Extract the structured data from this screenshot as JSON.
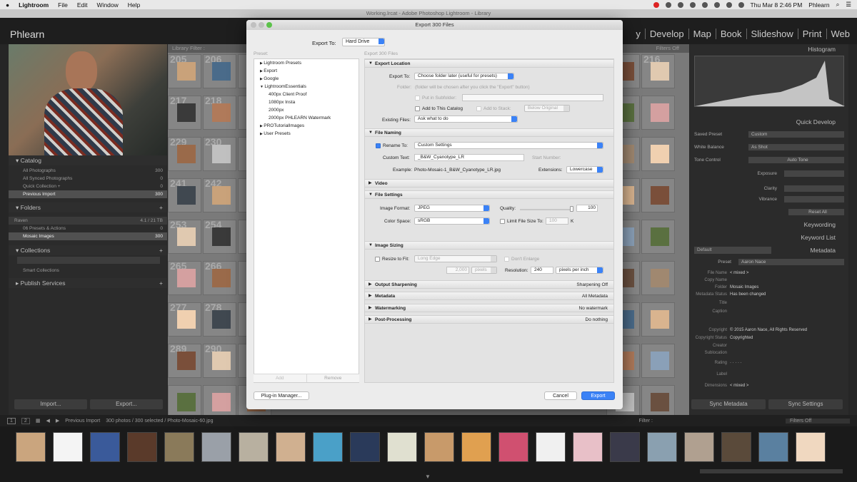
{
  "menubar": {
    "app": "Lightroom",
    "items": [
      "File",
      "Edit",
      "Window",
      "Help"
    ],
    "clock": "Thu Mar 8  2:46 PM",
    "user": "Phlearn"
  },
  "lr": {
    "window_title": "Working.lrcat - Adobe Photoshop Lightroom - Library",
    "brand": "Phlearn",
    "modules": [
      "y",
      "Develop",
      "Map",
      "Book",
      "Slideshow",
      "Print",
      "Web"
    ],
    "library_filter": "Library Filter :",
    "filters_off": "Filters Off"
  },
  "left": {
    "catalog": {
      "title": "Catalog",
      "items": [
        {
          "label": "All Photographs",
          "count": "300",
          "selected": false
        },
        {
          "label": "All Synced Photographs",
          "count": "0",
          "selected": false
        },
        {
          "label": "Quick Collection +",
          "count": "0",
          "selected": false
        },
        {
          "label": "Previous Import",
          "count": "300",
          "selected": true
        }
      ]
    },
    "folders": {
      "title": "Folders",
      "volume": "Raven",
      "volume_info": "4.1 / 21 TB",
      "items": [
        {
          "label": "06 Presets & Actions",
          "count": "0"
        },
        {
          "label": "Mosaic Images",
          "count": "300"
        }
      ]
    },
    "collections": {
      "title": "Collections",
      "items": [
        "Smart Collections"
      ]
    },
    "publish": "Publish Services",
    "import_btn": "Import...",
    "export_btn": "Export..."
  },
  "grid": {
    "row_numbers": [
      "205",
      "206",
      "217",
      "218",
      "229",
      "230",
      "241",
      "242",
      "253",
      "254",
      "265",
      "266",
      "277",
      "278",
      "289",
      "290"
    ],
    "right_numbers": [
      "216"
    ]
  },
  "right": {
    "histogram": "Histogram",
    "quick_develop": "Quick Develop",
    "saved_preset": {
      "label": "Saved Preset",
      "value": "Custom"
    },
    "white_balance": {
      "label": "White Balance",
      "value": "As Shot"
    },
    "tone_control": {
      "label": "Tone Control",
      "value": "Auto Tone"
    },
    "sliders": [
      "Exposure",
      "Clarity",
      "Vibrance"
    ],
    "reset": "Reset All",
    "keywording": "Keywording",
    "keyword_list": "Keyword List",
    "metadata": "Metadata",
    "meta_default": "Default",
    "meta_preset": {
      "label": "Preset",
      "value": "Aaron Nace"
    },
    "meta_rows": [
      {
        "k": "File Name",
        "v": "< mixed >"
      },
      {
        "k": "Copy Name",
        "v": ""
      },
      {
        "k": "Folder",
        "v": "Mosaic Images"
      },
      {
        "k": "Metadata Status",
        "v": "Has been changed"
      },
      {
        "k": "Title",
        "v": ""
      },
      {
        "k": "Caption",
        "v": ""
      },
      {
        "k": "Copyright",
        "v": "© 2015 Aaron Nace, All Rights Reserved"
      },
      {
        "k": "Copyright Status",
        "v": "Copyrighted"
      },
      {
        "k": "Creator",
        "v": ""
      },
      {
        "k": "Sublocation",
        "v": ""
      },
      {
        "k": "Rating",
        "v": "· · · · ·"
      },
      {
        "k": "Label",
        "v": ""
      },
      {
        "k": "Dimensions",
        "v": "< mixed >"
      }
    ],
    "sync_metadata": "Sync Metadata",
    "sync_settings": "Sync Settings"
  },
  "bottom": {
    "source": "Previous Import",
    "count": "300 photos / 300 selected / Photo-Mosaic-60.jpg",
    "filter": "Filter :",
    "filters_off": "Filters Off"
  },
  "dialog": {
    "title": "Export 300 Files",
    "export_to_label": "Export To:",
    "export_to_value": "Hard Drive",
    "preset_label": "Preset:",
    "files_label": "Export 300 Files",
    "presets": [
      {
        "label": "Lightroom Presets",
        "indent": 0,
        "arrow": "▶"
      },
      {
        "label": "Export",
        "indent": 0,
        "arrow": "▶"
      },
      {
        "label": "Google",
        "indent": 0,
        "arrow": "▶"
      },
      {
        "label": "LightroomEssentials",
        "indent": 0,
        "arrow": "▼"
      },
      {
        "label": "400px Client Proof",
        "indent": 1,
        "arrow": ""
      },
      {
        "label": "1080px Insta",
        "indent": 1,
        "arrow": ""
      },
      {
        "label": "2000px",
        "indent": 1,
        "arrow": ""
      },
      {
        "label": "2000px PHLEARN Watermark",
        "indent": 1,
        "arrow": ""
      },
      {
        "label": "PROTutorialImages",
        "indent": 0,
        "arrow": "▶"
      },
      {
        "label": "User Presets",
        "indent": 0,
        "arrow": "▶"
      }
    ],
    "add": "Add",
    "remove": "Remove",
    "location": {
      "title": "Export Location",
      "export_to_label": "Export To:",
      "export_to_value": "Choose folder later (useful for presets)",
      "folder_label": "Folder:",
      "folder_note": "(folder will be chosen after you click the \"Export\" button)",
      "subfolder_label": "Put in Subfolder:",
      "add_catalog_label": "Add to This Catalog",
      "add_stack_label": "Add to Stack:",
      "stack_value": "Below Original",
      "existing_label": "Existing Files:",
      "existing_value": "Ask what to do"
    },
    "naming": {
      "title": "File Naming",
      "rename_label": "Rename To:",
      "rename_value": "Custom Settings",
      "custom_text_label": "Custom Text:",
      "custom_text_value": "_B&W_Cyanotype_LR",
      "start_number_label": "Start Number:",
      "example_label": "Example:",
      "example_value": "Photo-Mosaic-1_B&W_Cyanotype_LR.jpg",
      "extensions_label": "Extensions:",
      "extensions_value": "Lowercase"
    },
    "video": {
      "title": "Video"
    },
    "file_settings": {
      "title": "File Settings",
      "format_label": "Image Format:",
      "format_value": "JPEG",
      "quality_label": "Quality:",
      "quality_value": "100",
      "quality_level": 1.0,
      "colorspace_label": "Color Space:",
      "colorspace_value": "sRGB",
      "limit_label": "Limit File Size To:",
      "limit_value": "100",
      "limit_unit": "K"
    },
    "sizing": {
      "title": "Image Sizing",
      "resize_label": "Resize to Fit:",
      "resize_value": "Long Edge",
      "dont_enlarge": "Don't Enlarge",
      "size_value": "2,000",
      "size_unit": "pixels",
      "resolution_label": "Resolution:",
      "resolution_value": "240",
      "resolution_unit": "pixels per inch"
    },
    "collapsed": [
      {
        "title": "Output Sharpening",
        "summary": "Sharpening Off"
      },
      {
        "title": "Metadata",
        "summary": "All Metadata"
      },
      {
        "title": "Watermarking",
        "summary": "No watermark"
      },
      {
        "title": "Post-Processing",
        "summary": "Do nothing"
      }
    ],
    "plugin_btn": "Plug-in Manager...",
    "cancel_btn": "Cancel",
    "export_btn": "Export"
  }
}
